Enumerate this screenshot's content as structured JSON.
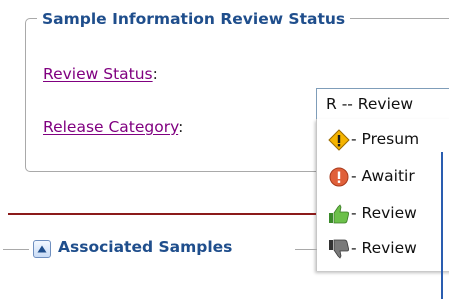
{
  "fieldset": {
    "legend": "Sample Information Review Status"
  },
  "fields": {
    "review_status_label": "Review Status",
    "release_category_label": "Release Category",
    "colon": ":"
  },
  "review_status_select": {
    "value": "R -- Review"
  },
  "dropdown": {
    "options": [
      {
        "label": "- Presum",
        "icon": "warning-diamond-icon"
      },
      {
        "label": "- Awaitir",
        "icon": "exclamation-circle-icon"
      },
      {
        "label": "- Review",
        "icon": "thumbs-up-icon"
      },
      {
        "label": "- Review",
        "icon": "thumbs-down-icon"
      }
    ]
  },
  "section": {
    "title": "Associated Samples",
    "toggle_icon": "collapse-triangle-up-icon"
  },
  "colors": {
    "heading_blue": "#1f4e8c",
    "link_purple": "#800080",
    "divider_red": "#8b1a1a"
  }
}
